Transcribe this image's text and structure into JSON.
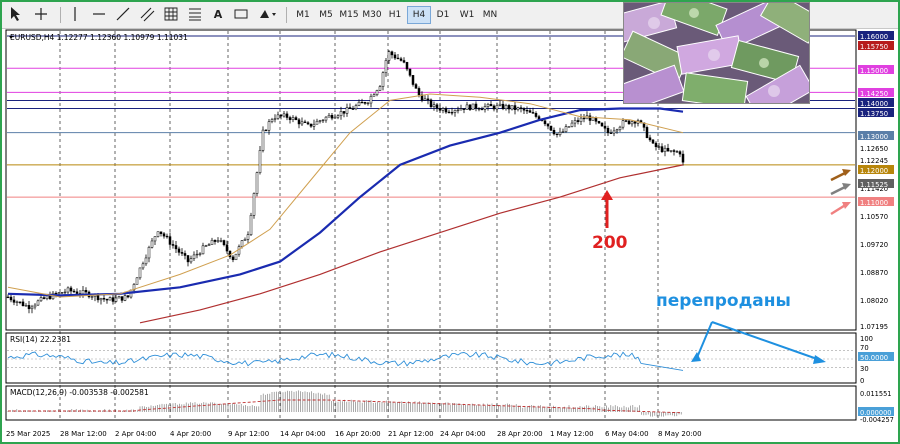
{
  "toolbar": {
    "timeframes": [
      "M1",
      "M5",
      "M15",
      "M30",
      "H1",
      "H4",
      "D1",
      "W1",
      "MN"
    ],
    "active_timeframe": "H4",
    "font_tool": "A"
  },
  "chart": {
    "symbol_info": "EURUSD,H4  1.12277 1.12360 1.10979 1.11031",
    "price_labels": [
      {
        "text": "1.16000",
        "color": "#ffffff",
        "bg": "#1a237e"
      },
      {
        "text": "1.15750",
        "color": "#ffffff",
        "bg": "#b71c1c"
      },
      {
        "text": "1.15000",
        "color": "#ffffff",
        "bg": "#e040e0"
      },
      {
        "text": "1.14250",
        "color": "#ffffff",
        "bg": "#e040e0"
      },
      {
        "text": "1.14000",
        "color": "#ffffff",
        "bg": "#1a237e"
      },
      {
        "text": "1.13750",
        "color": "#ffffff",
        "bg": "#1a237e"
      },
      {
        "text": "1.13000",
        "color": "#ffffff",
        "bg": "#5b7fa8"
      },
      {
        "text": "1.12650",
        "color": "#000000",
        "bg": ""
      },
      {
        "text": "1.12245",
        "color": "#000000",
        "bg": ""
      },
      {
        "text": "1.12000",
        "color": "#ffffff",
        "bg": "#b8860b"
      },
      {
        "text": "1.11420",
        "color": "#000000",
        "bg": ""
      },
      {
        "text": "1.11525",
        "color": "#ffffff",
        "bg": "#606060"
      },
      {
        "text": "1.11000",
        "color": "#ffffff",
        "bg": "#f08080"
      },
      {
        "text": "1.10570",
        "color": "#000000",
        "bg": ""
      },
      {
        "text": "1.09720",
        "color": "#000000",
        "bg": ""
      },
      {
        "text": "1.08870",
        "color": "#000000",
        "bg": ""
      },
      {
        "text": "1.08020",
        "color": "#000000",
        "bg": ""
      },
      {
        "text": "1.07195",
        "color": "#000000",
        "bg": ""
      }
    ],
    "annotation_200": "200",
    "annotation_oversold": "перепроданы"
  },
  "rsi": {
    "label": "RSI(14) 22.2381",
    "levels": [
      "100",
      "70",
      "50.0000",
      "30",
      "0"
    ]
  },
  "macd": {
    "label": "MACD(12,26,9) -0.003538 -0.002581",
    "levels": [
      "0.011551",
      "0.000000",
      "-0.004257"
    ]
  },
  "time_axis": [
    "25 Mar 2025",
    "28 Mar 12:00",
    "2 Apr 04:00",
    "4 Apr 20:00",
    "9 Apr 12:00",
    "14 Apr 04:00",
    "16 Apr 20:00",
    "21 Apr 12:00",
    "24 Apr 04:00",
    "28 Apr 20:00",
    "1 May 12:00",
    "6 May 04:00",
    "8 May 20:00"
  ],
  "colors": {
    "candle": "#000000",
    "ma_blue": "#1a2bb0",
    "ma_red": "#b03030",
    "ma_tan": "#d0a050",
    "rsi_line": "#2f8fd8",
    "arrow_red": "#e02020",
    "annotation_blue": "#1e90e0"
  }
}
